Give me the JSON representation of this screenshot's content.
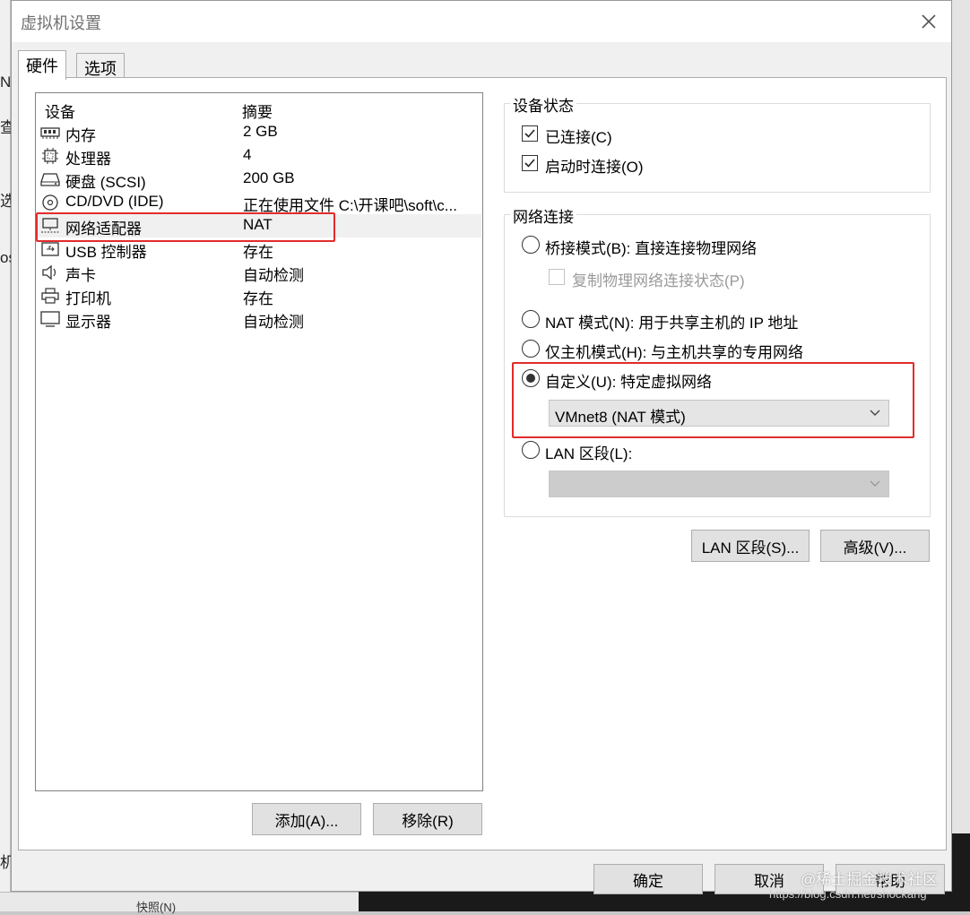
{
  "window": {
    "title": "虚拟机设置"
  },
  "tabs": [
    {
      "label": "硬件",
      "active": true
    },
    {
      "label": "选项",
      "active": false
    }
  ],
  "device_list": {
    "headers": {
      "device": "设备",
      "summary": "摘要"
    },
    "rows": [
      {
        "icon": "memory-icon",
        "name": "内存",
        "summary": "2 GB",
        "selected": false
      },
      {
        "icon": "processor-icon",
        "name": "处理器",
        "summary": "4",
        "selected": false
      },
      {
        "icon": "hard-disk-icon",
        "name": "硬盘 (SCSI)",
        "summary": "200 GB",
        "selected": false
      },
      {
        "icon": "cd-dvd-icon",
        "name": "CD/DVD (IDE)",
        "summary": "正在使用文件 C:\\开课吧\\soft\\c...",
        "selected": false
      },
      {
        "icon": "network-adapter-icon",
        "name": "网络适配器",
        "summary": "NAT",
        "selected": true
      },
      {
        "icon": "usb-controller-icon",
        "name": "USB 控制器",
        "summary": "存在",
        "selected": false
      },
      {
        "icon": "sound-card-icon",
        "name": "声卡",
        "summary": "自动检测",
        "selected": false
      },
      {
        "icon": "printer-icon",
        "name": "打印机",
        "summary": "存在",
        "selected": false
      },
      {
        "icon": "display-icon",
        "name": "显示器",
        "summary": "自动检测",
        "selected": false
      }
    ]
  },
  "list_buttons": {
    "add": "添加(A)...",
    "remove": "移除(R)"
  },
  "device_status": {
    "title": "设备状态",
    "connected": {
      "label": "已连接(C)",
      "checked": true
    },
    "connect_at_power_on": {
      "label": "启动时连接(O)",
      "checked": true
    }
  },
  "network_connection": {
    "title": "网络连接",
    "bridged": {
      "label": "桥接模式(B): 直接连接物理网络",
      "selected": false
    },
    "replicate": {
      "label": "复制物理网络连接状态(P)",
      "checked": false,
      "disabled": true
    },
    "nat": {
      "label": "NAT 模式(N): 用于共享主机的 IP 地址",
      "selected": false
    },
    "host_only": {
      "label": "仅主机模式(H): 与主机共享的专用网络",
      "selected": false
    },
    "custom": {
      "label": "自定义(U): 特定虚拟网络",
      "selected": true,
      "value": "VMnet8 (NAT 模式)"
    },
    "lan": {
      "label": "LAN 区段(L):",
      "selected": false,
      "value": ""
    }
  },
  "right_buttons": {
    "lan_segments": "LAN 区段(S)...",
    "advanced": "高级(V)..."
  },
  "footer_buttons": {
    "ok": "确定",
    "cancel": "取消",
    "help": "帮助"
  },
  "background_fragments": [
    "N",
    "查",
    "选",
    "os",
    "机"
  ],
  "background_bottom": "快照(N)",
  "watermark": "@稀土掘金技术社区",
  "watermark_url": "https://blog.csdn.net/shockang",
  "colors": {
    "highlight": "#e22b2b",
    "dialog_bg": "#f0f0f0",
    "selected_row": "#f0f0f0"
  }
}
